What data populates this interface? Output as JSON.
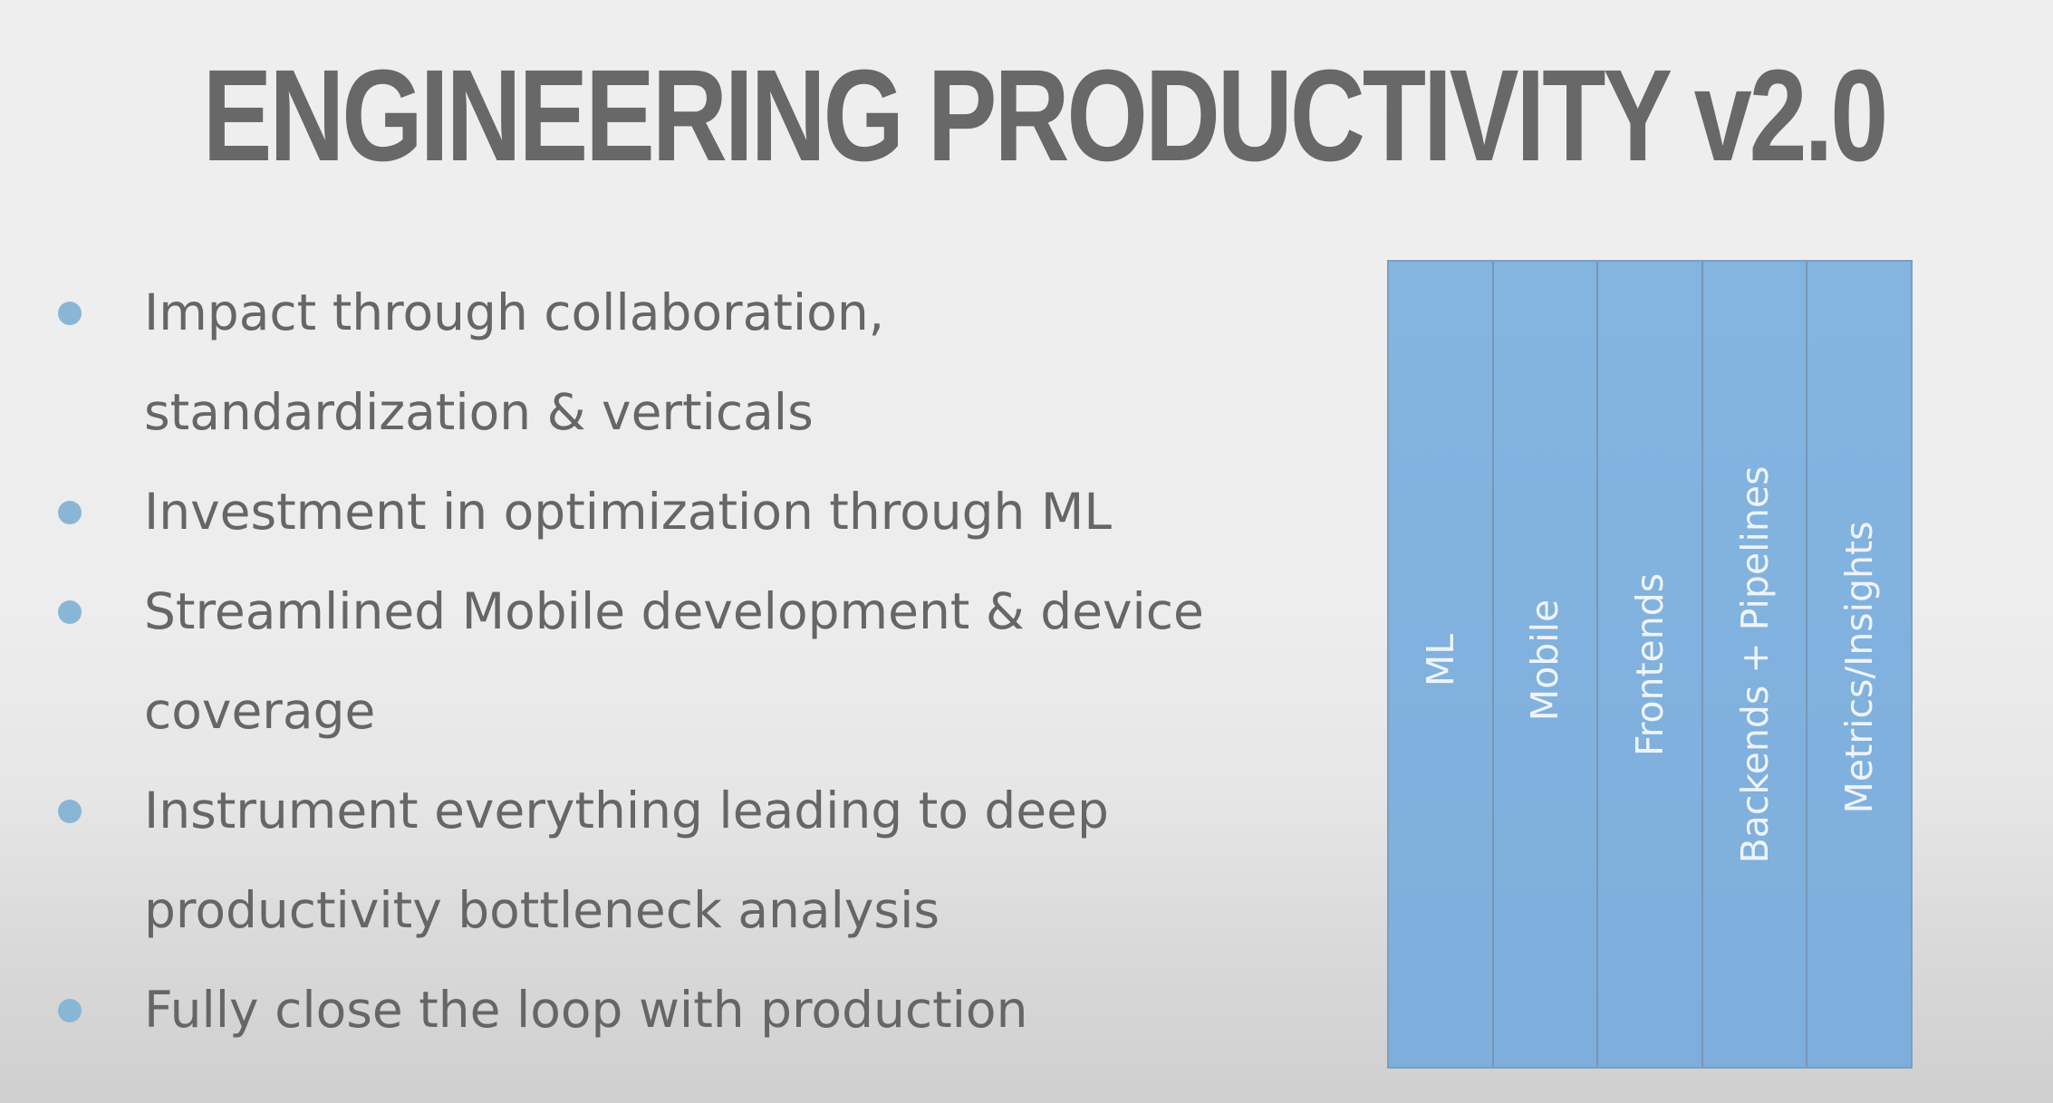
{
  "slide": {
    "title": "ENGINEERING PRODUCTIVITY v2.0",
    "bullets": [
      "Impact through collaboration, standardization & verticals",
      "Investment in optimization through ML",
      "Streamlined Mobile development & device coverage",
      "Instrument everything leading to deep productivity bottleneck analysis",
      "Fully close the loop with production"
    ],
    "pillars": [
      "ML",
      "Mobile",
      "Frontends",
      "Backends + Pipelines",
      "Metrics/Insights"
    ]
  },
  "colors": {
    "title": "#686868",
    "body_text": "#666666",
    "bullet_dot": "#8ab6d6",
    "pillar_fill": "#80b0dc",
    "pillar_text": "#eef4fa"
  }
}
